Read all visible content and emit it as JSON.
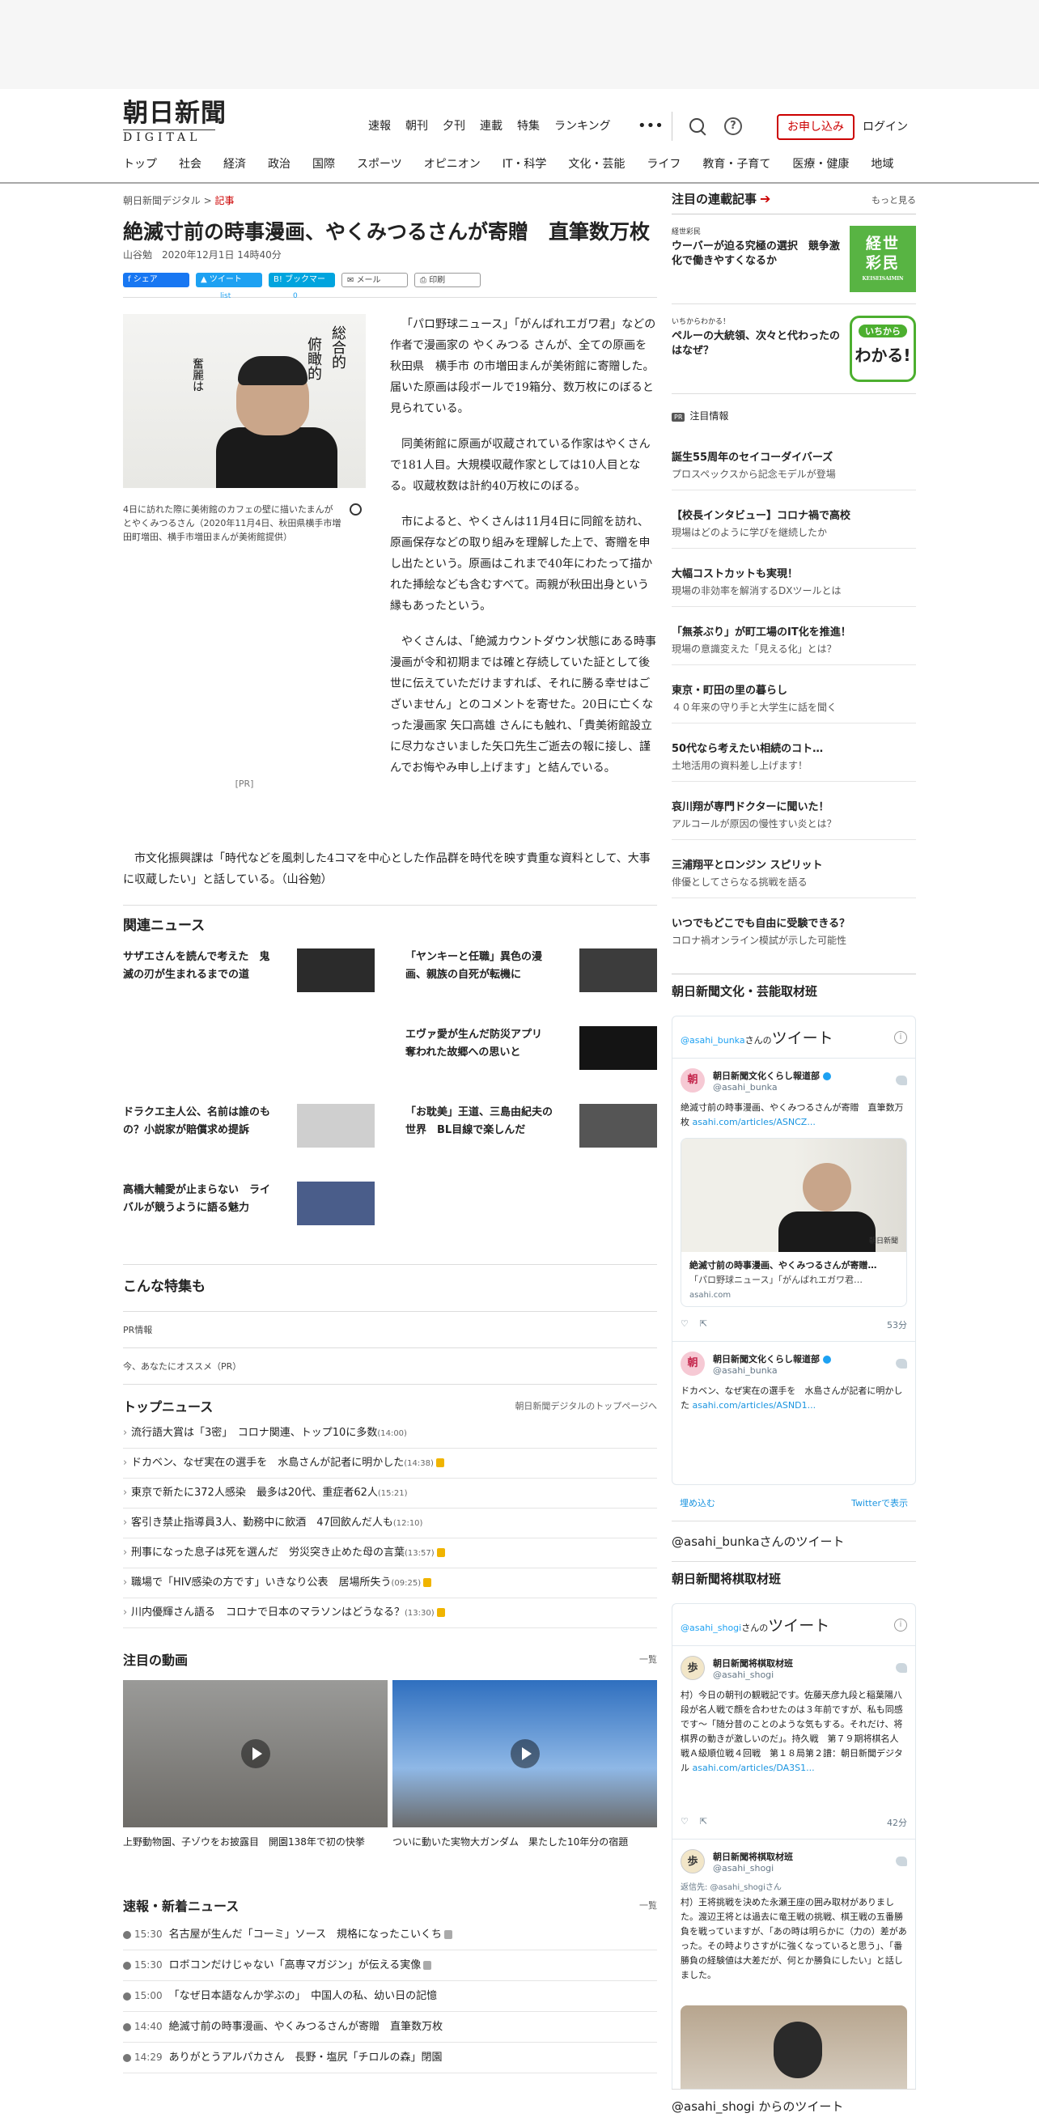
{
  "header": {
    "logo_main": "朝日新聞",
    "logo_sub": "DIGITAL",
    "top_nav": [
      "速報",
      "朝刊",
      "夕刊",
      "連載",
      "特集",
      "ランキング"
    ],
    "more": "•••",
    "help": "?",
    "subscribe": "お申し込み",
    "login": "ログイン",
    "main_nav": [
      "トップ",
      "社会",
      "経済",
      "政治",
      "国際",
      "スポーツ",
      "オピニオン",
      "IT・科学",
      "文化・芸能",
      "ライフ",
      "教育・子育て",
      "医療・健康",
      "地域"
    ]
  },
  "article": {
    "breadcrumb_site": "朝日新聞デジタル",
    "breadcrumb_sep": ">",
    "breadcrumb_cat": "記事",
    "title": "絶滅寸前の時事漫画、やくみつるさんが寄贈　直筆数万枚",
    "byline": "山谷勉　2020年12月1日 14時40分",
    "share": {
      "facebook": "シェア",
      "twitter": "ツイート",
      "twitter_count": "list",
      "hatena": "ブックマーク",
      "hatena_count": "0",
      "mail": "メール",
      "print": "印刷"
    },
    "photo_caption": "4日に訪れた際に美術館のカフェの壁に描いたまんがとやくみつるさん（2020年11月4日、秋田県横手市増田町増田、横手市増田まんが美術館提供）",
    "photo_text1": "総合的",
    "photo_text2": "俯瞰的",
    "photo_text3": "奮麗は",
    "pr": "[PR]",
    "paragraphs": [
      "「パロ野球ニュース」「がんばれエガワ君」などの作者で漫画家の やくみつる さんが、全ての原画を 秋田県　横手市 の市増田まんが美術館に寄贈した。届いた原画は段ボールで19箱分、数万枚にのぼると見られている。",
      "同美術館に原画が収蔵されている作家はやくさんで181人目。大規模収蔵作家としては10人目となる。収蔵枚数は計約40万枚にのぼる。",
      "市によると、やくさんは11月4日に同館を訪れ、原画保存などの取り組みを理解した上で、寄贈を申し出たという。原画はこれまで40年にわたって描かれた挿絵なども含むすべて。両親が秋田出身という縁もあったという。",
      "やくさんは、「絶滅カウントダウン状態にある時事漫画が令和初期までは確と存続していた証として後世に伝えていただけますれば、それに勝る幸せはございません」とのコメントを寄せた。20日に亡くなった漫画家 矢口高雄 さんにも触れ、「貴美術館設立に尽力なさいました矢口先生ご逝去の報に接し、謹んでお悔やみ申し上げます」と結んでいる。",
      "市文化振興課は「時代などを風刺した4コマを中心とした作品群を時代を映す貴重な資料として、大事に収蔵したい」と話している。（山谷勉）"
    ]
  },
  "related": {
    "heading": "関連ニュース",
    "items": [
      {
        "title": "サザエさんを読んで考えた　鬼滅の刃が生まれるまでの道",
        "color": "#2b2b2b"
      },
      {
        "title": "「ヤンキーと任職」異色の漫画、親族の自死が転機に",
        "color": "#3c3c3c"
      },
      {
        "title": "",
        "color": ""
      },
      {
        "title": "エヴァ愛が生んだ防災アプリ　奪われた故郷への思いと",
        "color": "#141414"
      },
      {
        "title": "ドラクエ主人公、名前は誰のもの？小説家が賠償求め提訴",
        "color": "#cfcfcf"
      },
      {
        "title": "「お耽美」王道、三島由紀夫の世界　BL目線で楽しんだ",
        "color": "#555555"
      },
      {
        "title": "高橋大輔愛が止まらない　ライバルが競うように語る魅力",
        "color": "#4a5d8a"
      }
    ]
  },
  "special": {
    "heading": "こんな特集も",
    "pr1": "PR情報",
    "pr2": "今、あなたにオススメ（PR）"
  },
  "topnews": {
    "heading": "トップニュース",
    "link": "朝日新聞デジタルのトップページへ",
    "items": [
      {
        "t": "流行語大賞は「3密」　コロナ関連、トップ10に多数",
        "time": "(14:00)",
        "lock": false
      },
      {
        "t": "ドカベン、なぜ実在の選手を　水島さんが記者に明かした",
        "time": "(14:38)",
        "lock": true
      },
      {
        "t": "東京で新たに372人感染　最多は20代、重症者62人",
        "time": "(15:21)",
        "lock": false
      },
      {
        "t": "客引き禁止指導員3人、勤務中に飲酒　47回飲んだ人も",
        "time": "(12:10)",
        "lock": false
      },
      {
        "t": "刑事になった息子は死を選んだ　労災突き止めた母の言葉",
        "time": "(13:57)",
        "lock": true
      },
      {
        "t": "職場で「HIV感染の方です」いきなり公表　居場所失う",
        "time": "(09:25)",
        "lock": true
      },
      {
        "t": "川内優輝さん語る　コロナで日本のマラソンはどうなる？",
        "time": "(13:30)",
        "lock": true
      }
    ]
  },
  "videos": {
    "heading": "注目の動画",
    "more": "一覧",
    "items": [
      {
        "t": "上野動物園、子ゾウをお披露目　開園138年で初の快挙"
      },
      {
        "t": "ついに動いた実物大ガンダム　果たした10年分の宿題"
      }
    ]
  },
  "breaking": {
    "heading": "速報・新着ニュース",
    "more": "一覧",
    "items": [
      {
        "time": "15:30",
        "t": "名古屋が生んだ「コーミ」ソース　規格になったこいくち",
        "lock": true
      },
      {
        "time": "15:30",
        "t": "ロボコンだけじゃない「高専マガジン」が伝える実像",
        "lock": true
      },
      {
        "time": "15:00",
        "t": "「なぜ日本語なんか学ぶの」　中国人の私、幼い日の記憶",
        "lock": false
      },
      {
        "time": "14:40",
        "t": "絶滅寸前の時事漫画、やくみつるさんが寄贈　直筆数万枚",
        "lock": false
      },
      {
        "time": "14:29",
        "t": "ありがとうアルパカさん　長野・塩尻「チロルの森」閉園",
        "lock": false
      }
    ]
  },
  "sidebar": {
    "series_heading": "注目の連載記事",
    "series_more": "もっと見る",
    "series": [
      {
        "tag": "経世彩民",
        "t": "ウーバーが迫る究極の選択　競争激化で働きやすくなるか",
        "icon_text": "経世彩民",
        "icon_sub": "KEISEISAIMIN"
      },
      {
        "tag": "いちからわかる！",
        "t": "ペルーの大統領、次々と代わったのはなぜ？",
        "icon_text": "わかる!",
        "icon_sub": "いちから"
      }
    ],
    "pr_badge": "PR",
    "pr_heading": "注目情報",
    "pr_items": [
      {
        "t": "誕生55周年のセイコーダイバーズ",
        "s": "プロスペックスから記念モデルが登場"
      },
      {
        "t": "【校長インタビュー】コロナ禍で高校",
        "s": "現場はどのように学びを継続したか"
      },
      {
        "t": "大幅コストカットも実現！",
        "s": "現場の非効率を解消するDXツールとは"
      },
      {
        "t": "「無茶ぶり」が町工場のIT化を推進！",
        "s": "現場の意識変えた「見える化」とは？"
      },
      {
        "t": "東京・町田の里の暮らし",
        "s": "４０年来の守り手と大学生に話を聞く"
      },
      {
        "t": "50代なら考えたい相続のコト…",
        "s": "土地活用の資料差し上げます！"
      },
      {
        "t": "哀川翔が専門ドクターに聞いた！",
        "s": "アルコールが原因の慢性すい炎とは？"
      },
      {
        "t": "三浦翔平とロンジン スピリット",
        "s": "俳優としてさらなる挑戦を語る"
      },
      {
        "t": "いつでもどこでも自由に受験できる？",
        "s": "コロナ禍オンライン模試が示した可能性"
      }
    ],
    "bunka_heading": "朝日新聞文化・芸能取材班",
    "tw1": {
      "handle": "@asahi_bunka",
      "handle_suffix": "さんの",
      "label": "ツイート",
      "info": "i",
      "t1_name": "朝日新聞文化くらし報道部",
      "t1_handle": "@asahi_bunka",
      "t1_text": "絶滅寸前の時事漫画、やくみつるさんが寄贈　直筆数万枚",
      "t1_link": "asahi.com/articles/ASNCZ...",
      "card_title": "絶滅寸前の時事漫画、やくみつるさんが寄贈…",
      "card_desc": "「パロ野球ニュース」「がんばれエガワ君…",
      "card_url": "asahi.com",
      "card_badge": "朝日新聞",
      "t1_time": "53分",
      "t2_name": "朝日新聞文化くらし報道部",
      "t2_handle": "@asahi_bunka",
      "t2_text": "ドカベン、なぜ実在の選手を　水島さんが記者に明かした",
      "t2_link": "asahi.com/articles/ASND1...",
      "embed": "埋め込む",
      "view": "Twitterで表示",
      "avatar": "朝"
    },
    "bunka_user": "@asahi_bunkaさんのツイート",
    "shogi_heading": "朝日新聞将棋取材班",
    "tw2": {
      "handle": "@asahi_shogi",
      "handle_suffix": "さんの",
      "label": "ツイート",
      "info": "i",
      "t1_name": "朝日新聞将棋取材班",
      "t1_handle": "@asahi_shogi",
      "t1_text": "村）今日の朝刊の観戦記です。佐藤天彦九段と稲葉陽八段が名人戦で顔を合わせたのは３年前ですが、私も同感です～「随分昔のことのような気もする。それだけ、将棋界の動きが激しいのだ」。持久戦　第７９期将棋名人戦Ａ級順位戦４回戦　第１８局第２譜：朝日新聞デジタル",
      "t1_link": "asahi.com/articles/DA3S1...",
      "t1_time": "42分",
      "t2_name": "朝日新聞将棋取材班",
      "t2_handle": "@asahi_shogi",
      "t2_reply": "返信先: @asahi_shogiさん",
      "t2_text": "村）王将挑戦を決めた永瀬王座の囲み取材がありました。渡辺王将とは過去に竜王戦の挑戦、棋王戦の五番勝負を戦っていますが、「あの時は明らかに（力の）差があった。その時よりさすがに強くなっていると思う」、「番勝負の経験値は大差だが、何とか勝負にしたい」と話しました。",
      "avatar": "歩"
    },
    "shogi_user": "@asahi_shogi からのツイート"
  }
}
